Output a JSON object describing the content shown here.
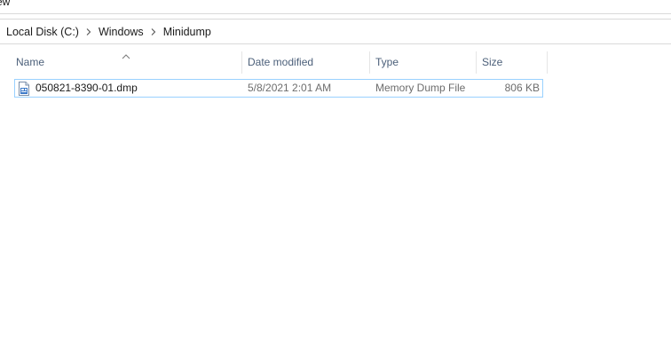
{
  "ribbon": {
    "partial_tab_label": "ew"
  },
  "breadcrumb": {
    "items": [
      "Local Disk (C:)",
      "Windows",
      "Minidump"
    ]
  },
  "columns": {
    "name": "Name",
    "date_modified": "Date modified",
    "type": "Type",
    "size": "Size",
    "sorted_by": "name",
    "sort_icon": "chevron-up-icon"
  },
  "files": [
    {
      "name": "050821-8390-01.dmp",
      "date_modified": "5/8/2021 2:01 AM",
      "type": "Memory Dump File",
      "size": "806 KB",
      "icon": "dump-file-icon"
    }
  ],
  "colors": {
    "header_text": "#4c607a",
    "selection_border": "#99d1ff",
    "secondary_text": "#6d6d6d"
  }
}
